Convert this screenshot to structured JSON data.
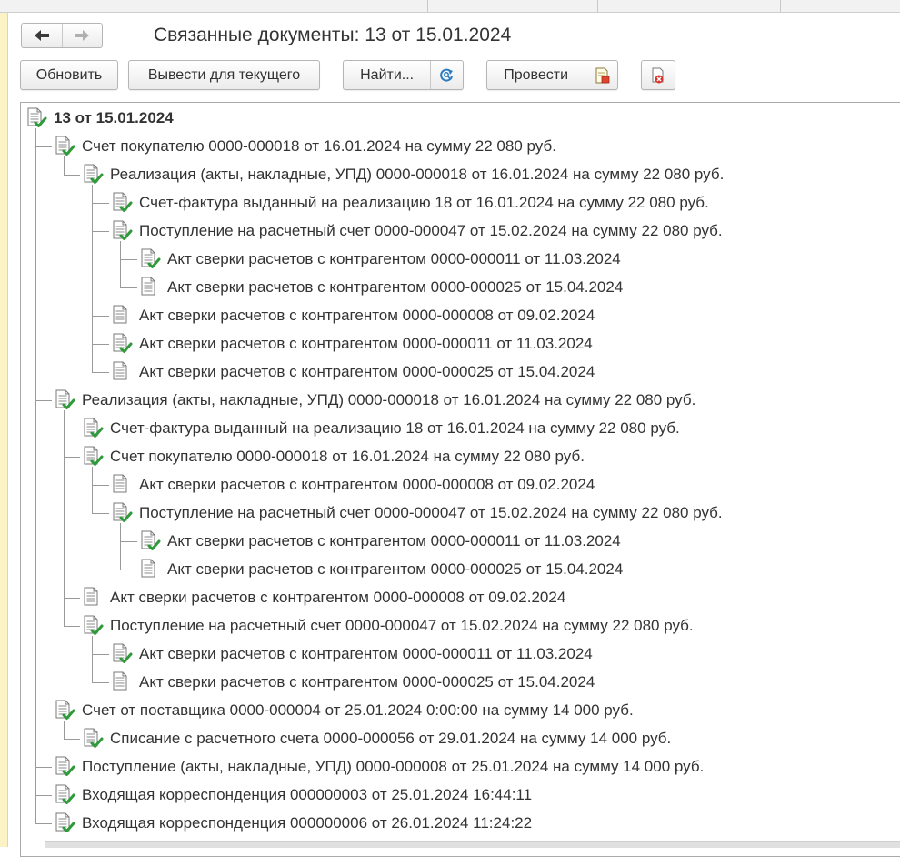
{
  "window": {
    "title": "Связанные документы: 13 от 15.01.2024"
  },
  "history": {
    "back_icon": "arrow-left-icon",
    "forward_icon": "arrow-right-icon"
  },
  "toolbar": {
    "refresh_label": "Обновить",
    "output_current_label": "Вывести для текущего",
    "find_label": "Найти...",
    "find_icon": "search-refresh-icon",
    "post_label": "Провести",
    "post_icon": "document-post-icon",
    "unpost_icon": "document-unpost-icon"
  },
  "tree": {
    "rows": [
      {
        "label": "13 от 15.01.2024",
        "icon": "document-posted-icon"
      },
      {
        "label": "Счет покупателю 0000-000018 от 16.01.2024 на сумму 22 080 руб.",
        "icon": "document-posted-icon"
      },
      {
        "label": "Реализация (акты, накладные, УПД) 0000-000018 от 16.01.2024 на сумму 22 080 руб.",
        "icon": "document-posted-icon"
      },
      {
        "label": "Счет-фактура выданный на реализацию 18 от 16.01.2024 на сумму 22 080 руб.",
        "icon": "document-posted-icon"
      },
      {
        "label": "Поступление на расчетный счет 0000-000047 от 15.02.2024 на сумму 22 080 руб.",
        "icon": "document-posted-icon"
      },
      {
        "label": "Акт сверки расчетов с контрагентом 0000-000011 от 11.03.2024",
        "icon": "document-posted-icon"
      },
      {
        "label": "Акт сверки расчетов с контрагентом 0000-000025 от 15.04.2024",
        "icon": "document-icon"
      },
      {
        "label": "Акт сверки расчетов с контрагентом 0000-000008 от 09.02.2024",
        "icon": "document-icon"
      },
      {
        "label": "Акт сверки расчетов с контрагентом 0000-000011 от 11.03.2024",
        "icon": "document-posted-icon"
      },
      {
        "label": "Акт сверки расчетов с контрагентом 0000-000025 от 15.04.2024",
        "icon": "document-icon"
      },
      {
        "label": "Реализация (акты, накладные, УПД) 0000-000018 от 16.01.2024 на сумму 22 080 руб.",
        "icon": "document-posted-icon"
      },
      {
        "label": "Счет-фактура выданный на реализацию 18 от 16.01.2024 на сумму 22 080 руб.",
        "icon": "document-posted-icon"
      },
      {
        "label": "Счет покупателю 0000-000018 от 16.01.2024 на сумму 22 080 руб.",
        "icon": "document-posted-icon"
      },
      {
        "label": "Акт сверки расчетов с контрагентом 0000-000008 от 09.02.2024",
        "icon": "document-icon"
      },
      {
        "label": "Поступление на расчетный счет 0000-000047 от 15.02.2024 на сумму 22 080 руб.",
        "icon": "document-posted-icon"
      },
      {
        "label": "Акт сверки расчетов с контрагентом 0000-000011 от 11.03.2024",
        "icon": "document-posted-icon"
      },
      {
        "label": "Акт сверки расчетов с контрагентом 0000-000025 от 15.04.2024",
        "icon": "document-icon"
      },
      {
        "label": "Акт сверки расчетов с контрагентом 0000-000008 от 09.02.2024",
        "icon": "document-icon"
      },
      {
        "label": "Поступление на расчетный счет 0000-000047 от 15.02.2024 на сумму 22 080 руб.",
        "icon": "document-posted-icon"
      },
      {
        "label": "Акт сверки расчетов с контрагентом 0000-000011 от 11.03.2024",
        "icon": "document-posted-icon"
      },
      {
        "label": "Акт сверки расчетов с контрагентом 0000-000025 от 15.04.2024",
        "icon": "document-icon"
      },
      {
        "label": "Счет от поставщика 0000-000004 от 25.01.2024 0:00:00 на сумму 14 000 руб.",
        "icon": "document-posted-icon"
      },
      {
        "label": "Списание с расчетного счета 0000-000056 от 29.01.2024 на сумму 14 000 руб.",
        "icon": "document-posted-icon"
      },
      {
        "label": "Поступление (акты, накладные, УПД) 0000-000008 от 25.01.2024 на сумму 14 000 руб.",
        "icon": "document-posted-icon"
      },
      {
        "label": "Входящая корреспонденция 000000003 от 25.01.2024 16:44:11",
        "icon": "document-posted-icon"
      },
      {
        "label": "Входящая корреспонденция 000000006 от 26.01.2024 11:24:22",
        "icon": "document-posted-icon"
      }
    ]
  },
  "colors": {
    "check_green": "#2e9a3a",
    "sheet_border": "#7a7a7a",
    "gutter_yellow": "#fbf3c6"
  }
}
